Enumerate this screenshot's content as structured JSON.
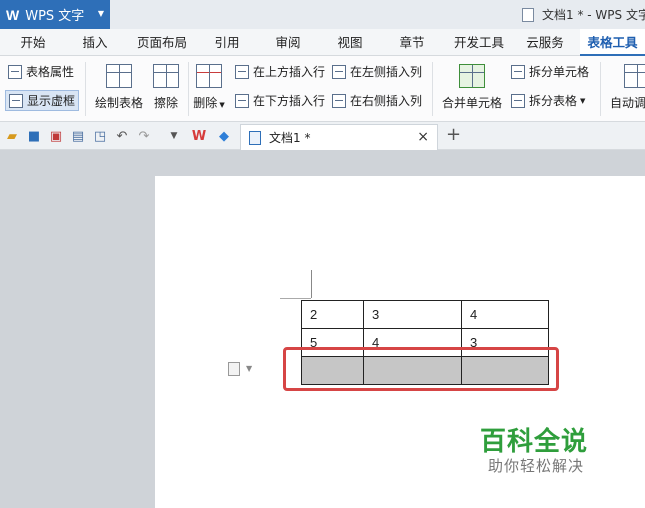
{
  "app": {
    "logo": "W",
    "name": "WPS 文字",
    "doc_title": "文档1 * - WPS 文字"
  },
  "menu": {
    "tabs": [
      "开始",
      "插入",
      "页面布局",
      "引用",
      "审阅",
      "视图",
      "章节",
      "开发工具",
      "云服务",
      "表格工具"
    ],
    "active": "表格工具"
  },
  "ribbon": {
    "table_props": "表格属性",
    "show_gridlines": "显示虚框",
    "draw_table": "绘制表格",
    "erase": "擦除",
    "delete": "删除",
    "insert_above": "在上方插入行",
    "insert_below": "在下方插入行",
    "insert_left": "在左侧插入列",
    "insert_right": "在右侧插入列",
    "merge_cells": "合并单元格",
    "split_cells": "拆分单元格",
    "split_table": "拆分表格",
    "autofit": "自动调"
  },
  "document_tab": {
    "title": "文档1 *",
    "close": "×",
    "add": "+"
  },
  "table": {
    "rows": [
      [
        "2",
        "3",
        "4"
      ],
      [
        "5",
        "4",
        "3"
      ],
      [
        "",
        "",
        ""
      ]
    ]
  },
  "watermark": {
    "title": "百科全说",
    "subtitle": "助你轻松解决"
  }
}
